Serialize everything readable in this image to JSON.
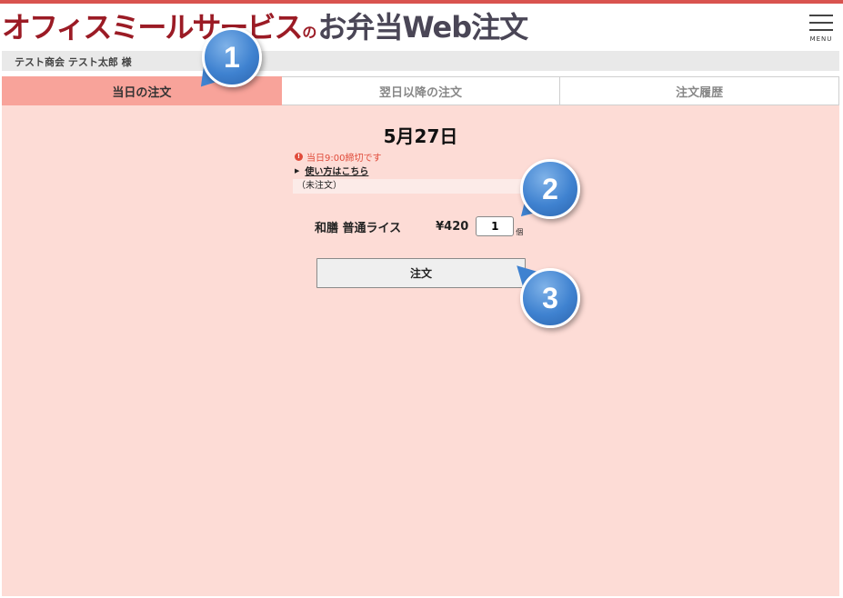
{
  "header": {
    "brand": "オフィスミールサービス",
    "connector": "の",
    "service": "お弁当Web注文",
    "menu_label": "MENU"
  },
  "user": {
    "name": "テスト商会 テスト太郎 様"
  },
  "tabs": [
    {
      "label": "当日の注文",
      "active": true
    },
    {
      "label": "翌日以降の注文",
      "active": false
    },
    {
      "label": "注文履歴",
      "active": false
    }
  ],
  "order": {
    "date": "5月27日",
    "deadline": "当日9:00締切です",
    "howto_link": "使い方はこちら",
    "status": "（未注文）",
    "item_name": "和膳 普通ライス",
    "price": "¥420",
    "quantity": "1",
    "unit": "個",
    "submit_label": "注文"
  },
  "callouts": [
    "1",
    "2",
    "3"
  ],
  "colors": {
    "accent": "#d9534f",
    "brand": "#9b1b25",
    "active_tab": "#f8a39a",
    "content_bg": "#fddcd6",
    "callout": "#3f82d0"
  }
}
